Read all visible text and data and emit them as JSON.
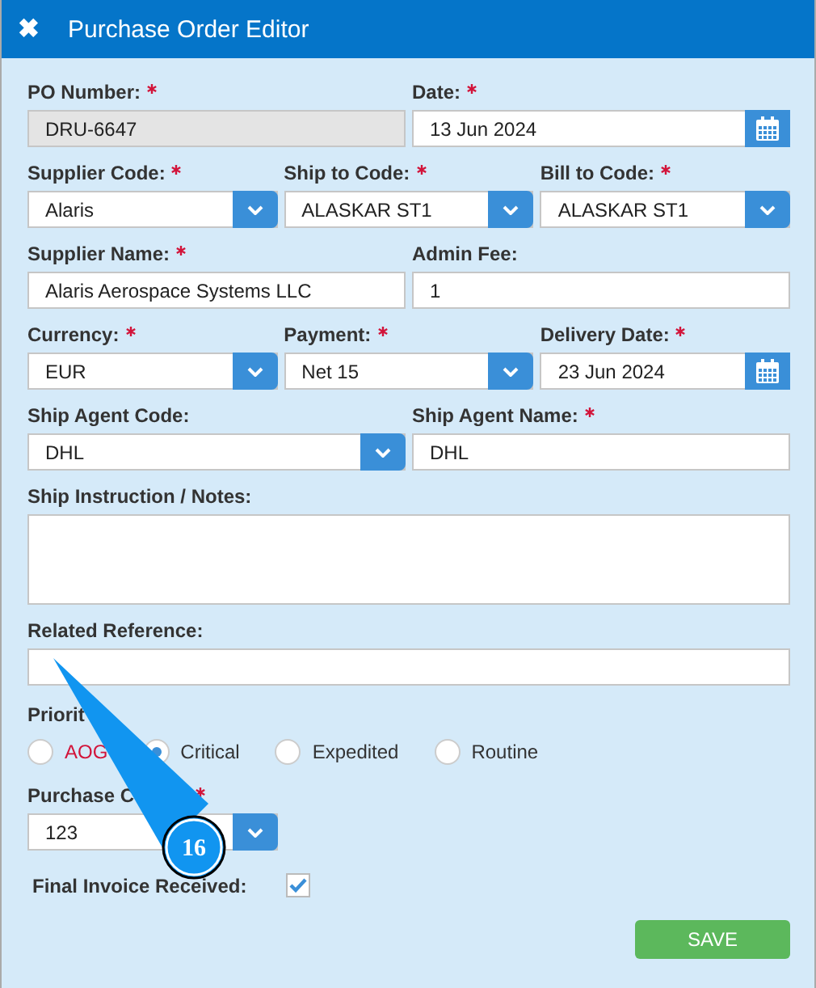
{
  "window": {
    "title": "Purchase Order Editor",
    "close": "✖"
  },
  "rows": [
    [
      {
        "label": "PO Number:",
        "required": true,
        "value": "DRU-6647",
        "kind": "readonly"
      },
      {
        "label": "Date:",
        "required": true,
        "value": "13 Jun 2024",
        "kind": "date"
      }
    ],
    [
      {
        "label": "Supplier Code:",
        "required": true,
        "value": "Alaris",
        "kind": "select"
      },
      {
        "label": "Ship to Code:",
        "required": true,
        "value": "ALASKAR ST1",
        "kind": "select"
      },
      {
        "label": "Bill to Code:",
        "required": true,
        "value": "ALASKAR ST1",
        "kind": "select"
      }
    ],
    [
      {
        "label": "Supplier Name:",
        "required": true,
        "value": "Alaris Aerospace Systems LLC",
        "kind": "text"
      },
      {
        "label": "Admin Fee:",
        "value": "1",
        "kind": "text"
      }
    ],
    [
      {
        "label": "Currency:",
        "required": true,
        "value": "EUR",
        "kind": "select"
      },
      {
        "label": "Payment:",
        "required": true,
        "value": "Net 15",
        "kind": "select"
      },
      {
        "label": "Delivery Date:",
        "required": true,
        "value": "23 Jun 2024",
        "kind": "date"
      }
    ],
    [
      {
        "label": "Ship Agent Code:",
        "value": "DHL",
        "kind": "select"
      },
      {
        "label": "Ship Agent Name:",
        "required": true,
        "value": "DHL",
        "kind": "text"
      }
    ],
    [
      {
        "label": "Ship Instruction / Notes:",
        "kind": "textarea"
      }
    ],
    [
      {
        "label": "Related Reference:",
        "kind": "text"
      }
    ]
  ],
  "priority": {
    "label": "Priorit",
    "options": [
      {
        "label": "AOG",
        "selected": false,
        "urgent": true
      },
      {
        "label": "Critical",
        "selected": true,
        "urgent": false
      },
      {
        "label": "Expedited",
        "selected": false,
        "urgent": false
      },
      {
        "label": "Routine",
        "selected": false,
        "urgent": false
      }
    ]
  },
  "purchase_code": {
    "label": "Purchase C",
    "required": true,
    "value": "123"
  },
  "final_invoice": {
    "label": "Final Invoice Received:",
    "checked": true
  },
  "save": "SAVE",
  "callout": "16"
}
